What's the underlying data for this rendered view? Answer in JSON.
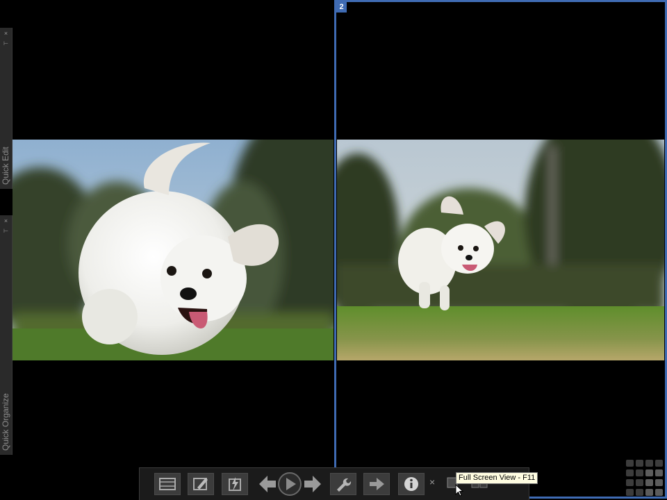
{
  "side_panels": {
    "quick_edit": {
      "label": "Quick Edit"
    },
    "quick_organize": {
      "label": "Quick Organize"
    },
    "close_glyph": "×",
    "pin_glyph": "⊢"
  },
  "viewer": {
    "active_pane_number": "2",
    "left_photo": "white-dog-close-up",
    "right_photo": "white-dog-running-on-grass"
  },
  "toolbar": {
    "buttons": [
      {
        "icon": "filmstrip-icon"
      },
      {
        "icon": "edit-icon"
      },
      {
        "icon": "quick-fix-icon"
      },
      {
        "icon": "previous-arrow-icon"
      },
      {
        "icon": "play-icon"
      },
      {
        "icon": "next-arrow-icon"
      },
      {
        "icon": "wrench-icon"
      },
      {
        "icon": "share-arrow-icon"
      },
      {
        "icon": "info-icon"
      },
      {
        "icon": "close-icon"
      },
      {
        "icon": "full-screen-view-icon"
      },
      {
        "icon": "side-by-side-view-icon"
      }
    ],
    "close_glyph": "×"
  },
  "tooltip": {
    "text": "Full Screen View - F11"
  },
  "colors": {
    "active_border": "#3f6bb3",
    "panel_bg": "#2a2a2a",
    "toolbar_bg": "#1b1b1b",
    "tooltip_bg": "#fffde1"
  }
}
